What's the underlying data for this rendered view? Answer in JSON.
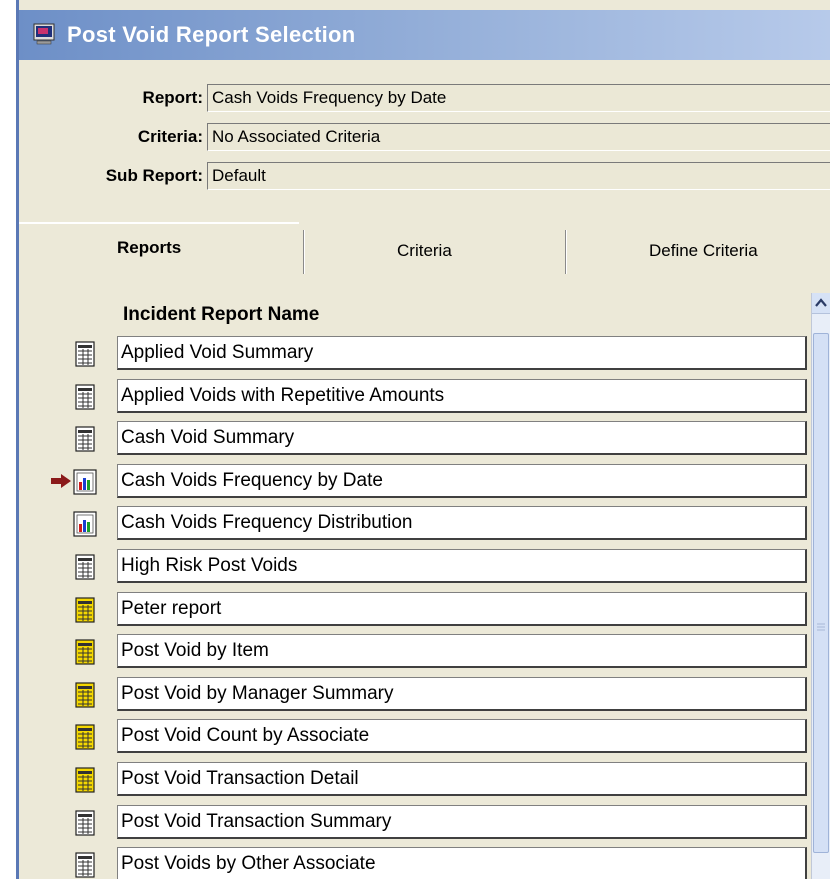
{
  "window": {
    "title": "Post Void Report Selection"
  },
  "fields": {
    "report_label": "Report:",
    "report_value": "Cash Voids Frequency by Date",
    "criteria_label": "Criteria:",
    "criteria_value": "No Associated Criteria",
    "subreport_label": "Sub Report:",
    "subreport_value": "Default"
  },
  "tabs": [
    {
      "label": "Reports",
      "active": true
    },
    {
      "label": "Criteria",
      "active": false
    },
    {
      "label": "Define Criteria",
      "active": false
    }
  ],
  "list": {
    "header": "Incident Report Name",
    "selected_index": 3,
    "items": [
      {
        "name": "Applied Void Summary",
        "icon": "gray-report-icon"
      },
      {
        "name": "Applied Voids with Repetitive Amounts",
        "icon": "gray-report-icon"
      },
      {
        "name": "Cash Void Summary",
        "icon": "gray-report-icon"
      },
      {
        "name": "Cash Voids Frequency by Date",
        "icon": "chart-report-icon"
      },
      {
        "name": "Cash Voids Frequency Distribution",
        "icon": "chart-report-icon"
      },
      {
        "name": "High Risk Post Voids",
        "icon": "gray-report-icon"
      },
      {
        "name": "Peter report",
        "icon": "yellow-report-icon"
      },
      {
        "name": "Post Void by Item",
        "icon": "yellow-report-icon"
      },
      {
        "name": "Post Void by Manager Summary",
        "icon": "yellow-report-icon"
      },
      {
        "name": "Post Void Count by Associate",
        "icon": "yellow-report-icon"
      },
      {
        "name": "Post Void Transaction Detail",
        "icon": "yellow-report-icon"
      },
      {
        "name": "Post Void Transaction Summary",
        "icon": "gray-report-icon"
      },
      {
        "name": "Post Voids by Other Associate",
        "icon": "gray-report-icon"
      }
    ]
  },
  "colors": {
    "titlebar": "#6d8fc7",
    "background": "#ece9d8",
    "arrow": "#8b1a1a"
  }
}
